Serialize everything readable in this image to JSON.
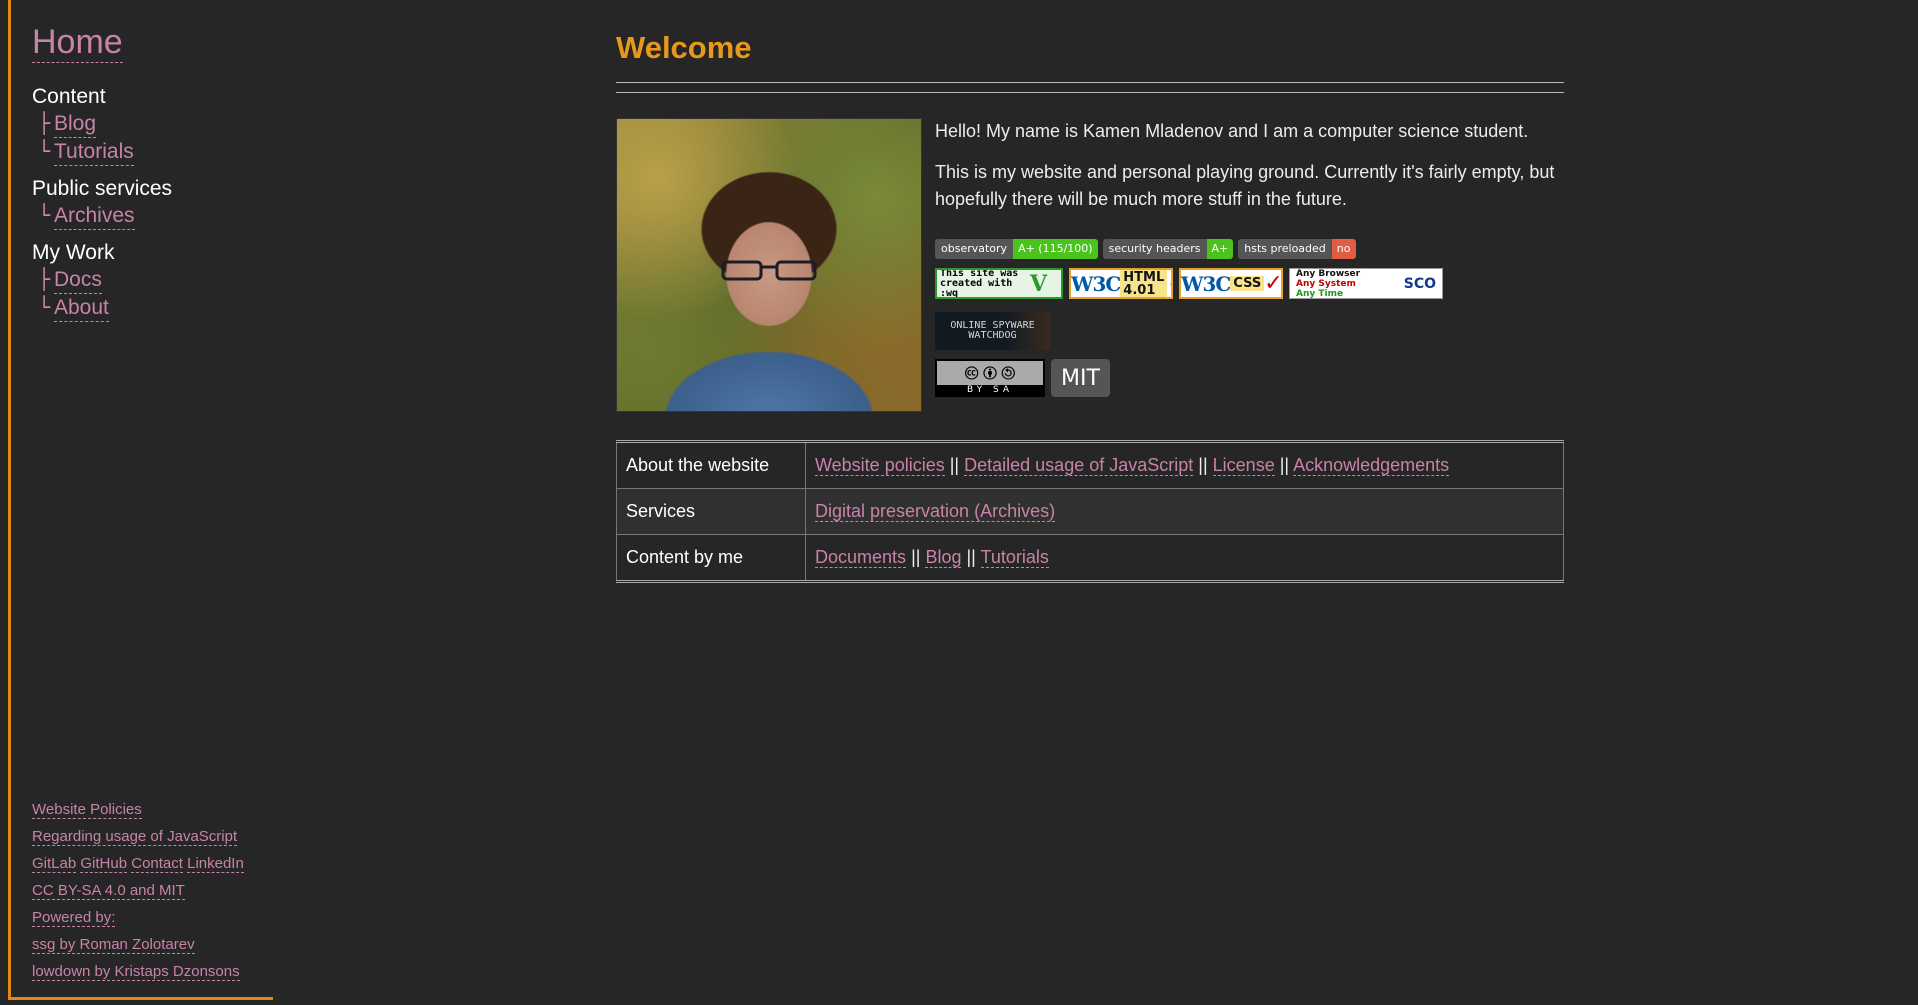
{
  "sidebar": {
    "home": "Home",
    "groups": [
      {
        "heading": "Content",
        "items": [
          "Blog",
          "Tutorials"
        ]
      },
      {
        "heading": "Public services",
        "items": [
          "Archives"
        ]
      },
      {
        "heading": "My Work",
        "items": [
          "Docs",
          "About"
        ]
      }
    ],
    "footer": {
      "policies": "Website Policies",
      "javascript": "Regarding usage of JavaScript",
      "gitlab": "GitLab",
      "github": "GitHub",
      "contact": "Contact",
      "linkedin": "LinkedIn",
      "license": "CC BY-SA 4.0 and MIT",
      "powered_by": "Powered by:",
      "ssg": "ssg by Roman Zolotarev",
      "lowdown": "lowdown by Kristaps Dzonsons"
    }
  },
  "main": {
    "title": "Welcome",
    "intro": [
      "Hello! My name is Kamen Mladenov and I am a computer science student.",
      "This is my website and personal playing ground. Currently it's fairly empty, but hopefully there will be much more stuff in the future."
    ],
    "badges": [
      {
        "key": "observatory",
        "value": "A+ (115/100)",
        "color": "#4ac41d"
      },
      {
        "key": "security headers",
        "value": "A+",
        "color": "#4ac41d"
      },
      {
        "key": "hsts preloaded",
        "value": "no",
        "color": "#e05d44"
      }
    ],
    "buttons": {
      "vim": "This site was created with :wq",
      "html": "HTML 4.01",
      "css": "CSS",
      "w3c": "W3C",
      "any_lines": [
        "Any Browser",
        "Any System",
        "Any Time"
      ],
      "sco": "SCO",
      "spyware": "ONLINE SPYWARE WATCHDOG",
      "cc_label": "BY SA",
      "mit": "MIT"
    },
    "table": [
      {
        "label": "About the website",
        "links": [
          "Website policies",
          "Detailed usage of JavaScript",
          "License",
          "Acknowledgements"
        ]
      },
      {
        "label": "Services",
        "links": [
          "Digital preservation (Archives)"
        ]
      },
      {
        "label": "Content by me",
        "links": [
          "Documents",
          "Blog",
          "Tutorials"
        ]
      }
    ],
    "separator": "||"
  },
  "colors": {
    "background": "#262626",
    "accent": "#e08a14",
    "link": "#c883a8",
    "title": "#e8991c"
  }
}
